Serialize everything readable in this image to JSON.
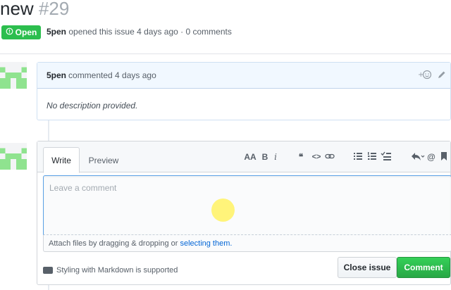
{
  "issue": {
    "title": "new",
    "number": "#29",
    "state": "Open",
    "author": "5pen",
    "meta_rest": "opened this issue 4 days ago · 0 comments"
  },
  "comment": {
    "author": "5pen",
    "header_rest": "commented 4 days ago",
    "reaction_icon": "smiley-icon",
    "edit_icon": "pencil-icon",
    "body": "No description provided."
  },
  "editor": {
    "tabs": [
      "Write",
      "Preview"
    ],
    "placeholder": "Leave a comment",
    "toolbar": {
      "heading": "AA",
      "bold": "B",
      "italic": "i",
      "quote": "❝",
      "code": "<>",
      "link": "link-icon",
      "ul": "unordered-list-icon",
      "ol": "ordered-list-icon",
      "task": "task-list-icon",
      "reply": "reply-icon",
      "mention": "@",
      "saved": "bookmark-icon"
    },
    "attach_text": "Attach files by dragging & dropping or",
    "attach_link": "selecting them.",
    "markdown_note": "Styling with Markdown is supported",
    "close_button": "Close issue",
    "comment_button": "Comment"
  },
  "colors": {
    "open_green": "#2cbe4e",
    "comment_green": "#28a745",
    "link_blue": "#0366d6",
    "header_blue": "#f1f8ff"
  }
}
